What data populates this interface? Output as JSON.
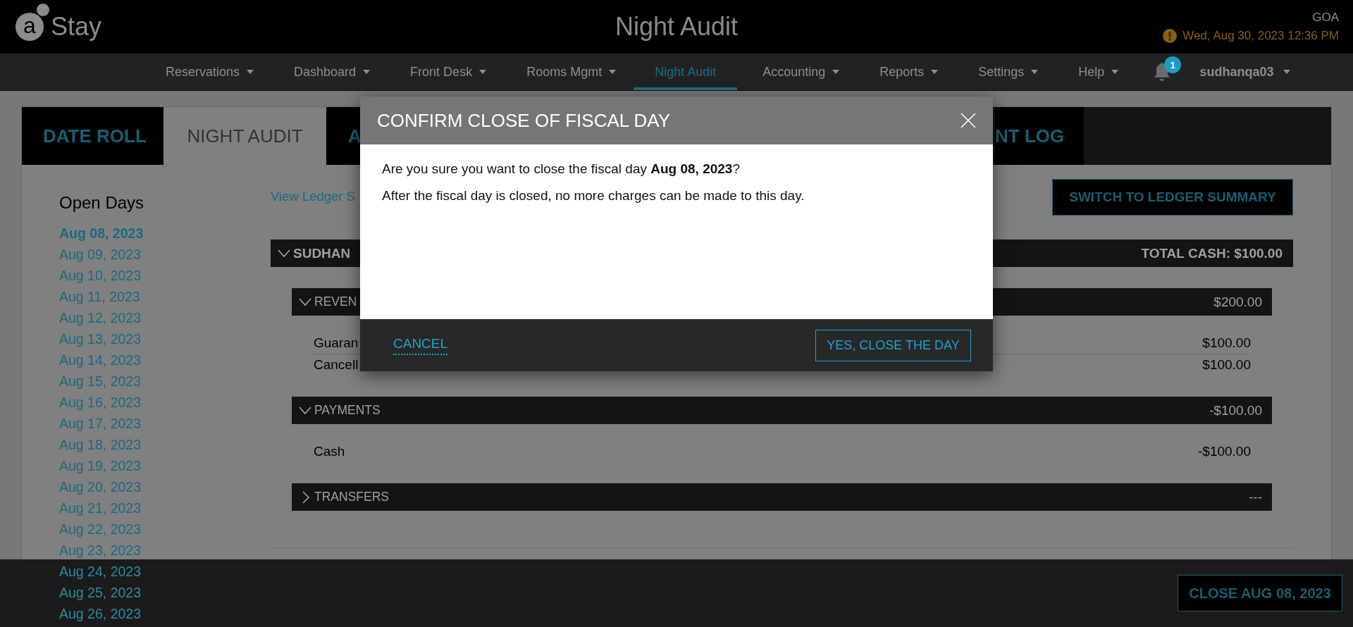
{
  "header": {
    "logo": {
      "mark": "a",
      "name": "Stay"
    },
    "title": "Night Audit",
    "location": "GOA",
    "datetime": "Wed, Aug 30, 2023 12:36 PM"
  },
  "nav": [
    {
      "label": "Reservations",
      "selected": false
    },
    {
      "label": "Dashboard",
      "selected": false
    },
    {
      "label": "Front Desk",
      "selected": false
    },
    {
      "label": "Rooms Mgmt",
      "selected": false
    },
    {
      "label": "Night Audit",
      "selected": true
    },
    {
      "label": "Accounting",
      "selected": false
    },
    {
      "label": "Reports",
      "selected": false
    },
    {
      "label": "Settings",
      "selected": false
    },
    {
      "label": "Help",
      "selected": false
    }
  ],
  "notifications": {
    "count": "1"
  },
  "user": "sudhanqa03",
  "tabs": [
    {
      "label": "DATE ROLL",
      "selected": false
    },
    {
      "label": "NIGHT AUDIT",
      "selected": true
    },
    {
      "label": "A",
      "selected": false
    },
    {
      "label": "NT LOG",
      "selected": false
    }
  ],
  "open_days": {
    "title": "Open Days",
    "days": [
      {
        "label": "Aug 08, 2023",
        "selected": true
      },
      {
        "label": "Aug 09, 2023",
        "selected": false
      },
      {
        "label": "Aug 10, 2023",
        "selected": false
      },
      {
        "label": "Aug 11, 2023",
        "selected": false
      },
      {
        "label": "Aug 12, 2023",
        "selected": false
      },
      {
        "label": "Aug 13, 2023",
        "selected": false
      },
      {
        "label": "Aug 14, 2023",
        "selected": false
      },
      {
        "label": "Aug 15, 2023",
        "selected": false
      },
      {
        "label": "Aug 16, 2023",
        "selected": false
      },
      {
        "label": "Aug 17, 2023",
        "selected": false
      },
      {
        "label": "Aug 18, 2023",
        "selected": false
      },
      {
        "label": "Aug 19, 2023",
        "selected": false
      },
      {
        "label": "Aug 20, 2023",
        "selected": false
      },
      {
        "label": "Aug 21, 2023",
        "selected": false
      },
      {
        "label": "Aug 22, 2023",
        "selected": false
      },
      {
        "label": "Aug 23, 2023",
        "selected": false
      },
      {
        "label": "Aug 24, 2023",
        "selected": false
      },
      {
        "label": "Aug 25, 2023",
        "selected": false
      },
      {
        "label": "Aug 26, 2023",
        "selected": false
      }
    ]
  },
  "ledger": {
    "link": "View Ledger S",
    "switch_button": "SWITCH TO LEDGER SUMMARY",
    "account": {
      "title": "SUDHAN",
      "expanded": true,
      "total": "TOTAL CASH: $100.00",
      "groups": [
        {
          "title": "REVEN",
          "expanded": true,
          "amount": "$200.00",
          "rows": [
            {
              "label": "Guaran",
              "amount": "$100.00"
            },
            {
              "label": "Cancell",
              "amount": "$100.00"
            }
          ]
        },
        {
          "title": "PAYMENTS",
          "expanded": true,
          "amount": "-$100.00",
          "rows": [
            {
              "label": "Cash",
              "amount": "-$100.00"
            }
          ]
        },
        {
          "title": "TRANSFERS",
          "expanded": false,
          "amount": "---"
        }
      ]
    }
  },
  "footer": {
    "close_button": "CLOSE AUG 08, 2023"
  },
  "dialog": {
    "title": "CONFIRM CLOSE OF FISCAL DAY",
    "message": "Are you sure you want to close the fiscal day **Aug 08, 2023**?",
    "note": "After the fiscal day is closed, no more charges can be made to this day.",
    "cancel": "CANCEL",
    "confirm": "YES, CLOSE THE DAY"
  }
}
